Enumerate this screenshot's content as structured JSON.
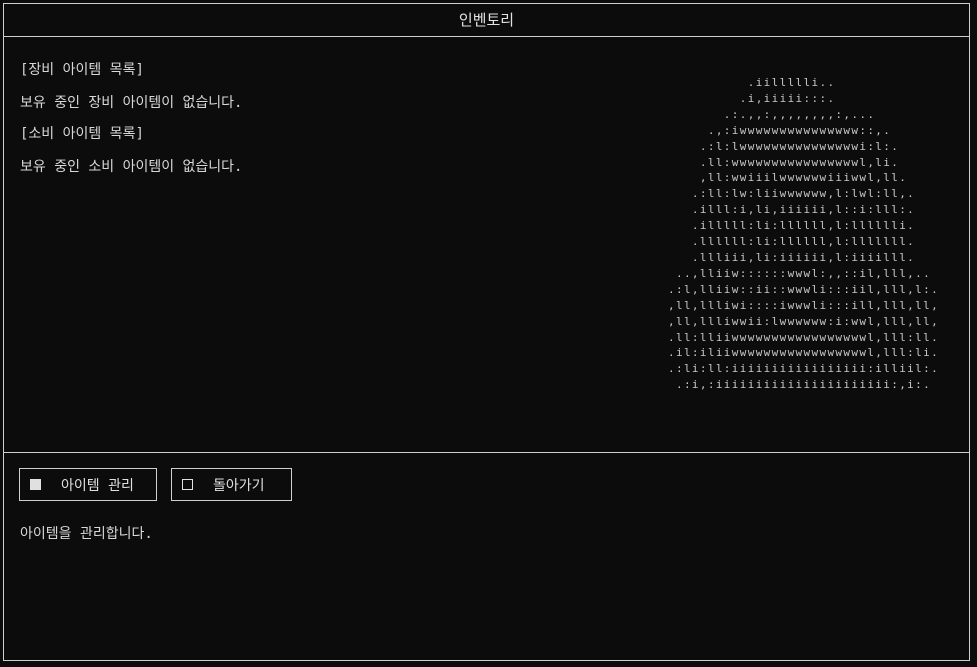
{
  "window": {
    "title": "인벤토리"
  },
  "inventory": {
    "equipment_header": "[장비 아이템 목록]",
    "equipment_empty": "보유 중인 장비 아이템이 없습니다.",
    "consumable_header": "[소비 아이템 목록]",
    "consumable_empty": "보유 중인 소비 아이템이 없습니다."
  },
  "character_art": "          .iillllli..\n         .i,iiiii:::.\n       .:.,,:,,,,,,,,:,...\n     .,:iwwwwwwwwwwwwwww::,.\n    .:l:lwwwwwwwwwwwwwwwi:l:.\n    .ll:wwwwwwwwwwwwwwwwl,li.\n    ,ll:wwiiilwwwwwwiiiwwl,ll.\n   .:ll:lw:liiwwwwww,l:lwl:ll,.\n   .illl:i,li,iiiiii,l::i:lll:.\n   .illlll:li:llllll,l:lllllli.\n   .llllll:li:llllll,l:lllllll.\n   .llliii,li:iiiiii,l:iiiilll.\n ..,lliiw::::::wwwl:,,::il,lll,..\n.:l,lliiw::ii::wwwli:::iil,lll,l:.\n,ll,llliwi::::iwwwli:::ill,lll,ll,\n,ll,llliwwii:lwwwwww:i:wwl,lll,ll,\n.ll:lliiwwwwwwwwwwwwwwwwwl,lll:ll.\n.il:iliiwwwwwwwwwwwwwwwwwl,lll:li.\n.:li:ll:iiiiiiiiiiiiiiiii:illiil:.\n .:i,:iiiiiiiiiiiiiiiiiiiiii:,i:.",
  "menu": {
    "manage_label": "아이템 관리",
    "back_label": "돌아가기"
  },
  "status": {
    "description": "아이템을 관리합니다."
  },
  "colors": {
    "background": "#0c0c0c",
    "border": "#cfcfcf",
    "text": "#d8d8d8"
  }
}
